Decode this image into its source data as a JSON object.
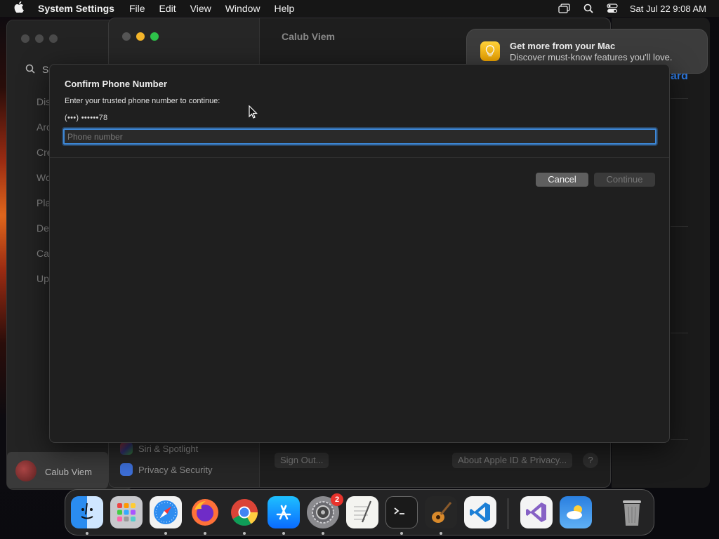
{
  "menubar": {
    "app_name": "System Settings",
    "items": [
      "File",
      "Edit",
      "View",
      "Window",
      "Help"
    ],
    "clock": "Sat Jul 22  9:08 AM"
  },
  "background_window": {
    "title": "Calub Viem",
    "search_partial": "Sea",
    "left_partial_items": [
      "Dis",
      "Arc",
      "Cre",
      "Wo",
      "Pla",
      "De",
      "Ca",
      "Up"
    ],
    "sidebar_items": [
      "Siri & Spotlight",
      "Privacy & Security"
    ],
    "user_name": "Calub Viem",
    "sign_out_label": "Sign Out...",
    "about_label": "About Apple ID & Privacy...",
    "help_label": "?",
    "right_partial_link": "ard"
  },
  "notification": {
    "title": "Get more from your Mac",
    "body": "Discover must-know features you'll love."
  },
  "dialog": {
    "title": "Confirm Phone Number",
    "subtitle": "Enter your trusted phone number to continue:",
    "masked_number": "(•••) ••••••78",
    "input_placeholder": "Phone number",
    "input_value": "",
    "cancel_label": "Cancel",
    "continue_label": "Continue"
  },
  "dock": {
    "settings_badge": "2",
    "apps": [
      "Finder",
      "Launchpad",
      "Safari",
      "Firefox",
      "Chrome",
      "App Store",
      "System Settings",
      "TextEdit",
      "Terminal",
      "GarageBand",
      "Visual Studio Code",
      "Visual Studio",
      "Weather",
      "Trash"
    ]
  },
  "colors": {
    "accent": "#3d88d8",
    "badge": "#e8332c",
    "link": "#2d7be6"
  }
}
